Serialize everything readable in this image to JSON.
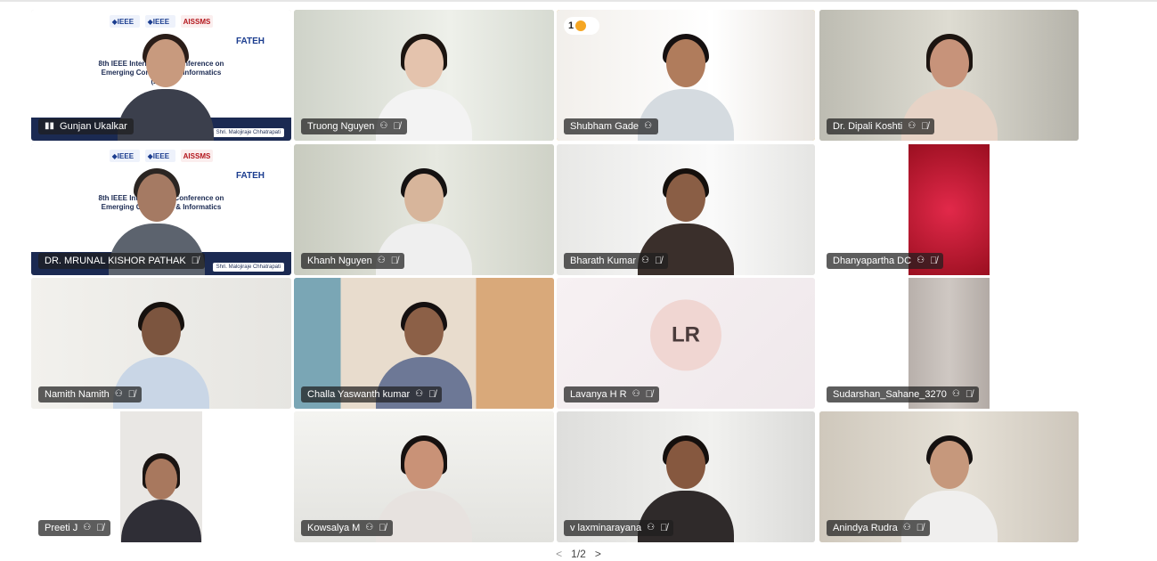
{
  "meeting": {
    "participants": [
      {
        "name": "Gunjan Ukalkar",
        "has_signal_icon": true,
        "muted": false
      },
      {
        "name": "Truong Nguyen",
        "muted": true
      },
      {
        "name": "Shubham Gade",
        "muted": false,
        "raised_hand_count": "1"
      },
      {
        "name": "Dr. Dipali Koshti",
        "muted": true
      },
      {
        "name": "DR. MRUNAL KISHOR PATHAK",
        "muted": true
      },
      {
        "name": "Khanh Nguyen",
        "muted": true
      },
      {
        "name": "Bharath Kumar",
        "muted": true
      },
      {
        "name": "Dhanyapartha DC",
        "muted": true
      },
      {
        "name": "Namith Namith",
        "muted": true
      },
      {
        "name": "Challa Yaswanth kumar",
        "muted": true
      },
      {
        "name": "Lavanya H R",
        "muted": true,
        "initials": "LR"
      },
      {
        "name": "Sudarshan_Sahane_3270",
        "muted": true
      },
      {
        "name": "Preeti J",
        "muted": true
      },
      {
        "name": "Kowsalya M",
        "muted": true
      },
      {
        "name": "v laxminarayana",
        "muted": true
      },
      {
        "name": "Anindya Rudra",
        "muted": true
      }
    ],
    "shared_banner": {
      "logos": [
        "◆IEEE",
        "◆IEEE",
        "AISSMS"
      ],
      "sponsor": "FATEH",
      "title_lines": [
        "8th IEEE International Conference on",
        "Emerging Computing & Informatics",
        "(2026)"
      ],
      "chip": "Shri. Malojiraje Chhatrapati"
    },
    "pager": {
      "label": "1/2",
      "prev": "<",
      "next": ">"
    }
  },
  "colors": {
    "active_speaker_border": "#f0b429",
    "nameplate_bg": "rgba(30,30,30,0.72)",
    "banner_navy": "#1b2a52",
    "raise_hand": "#f5a623"
  }
}
